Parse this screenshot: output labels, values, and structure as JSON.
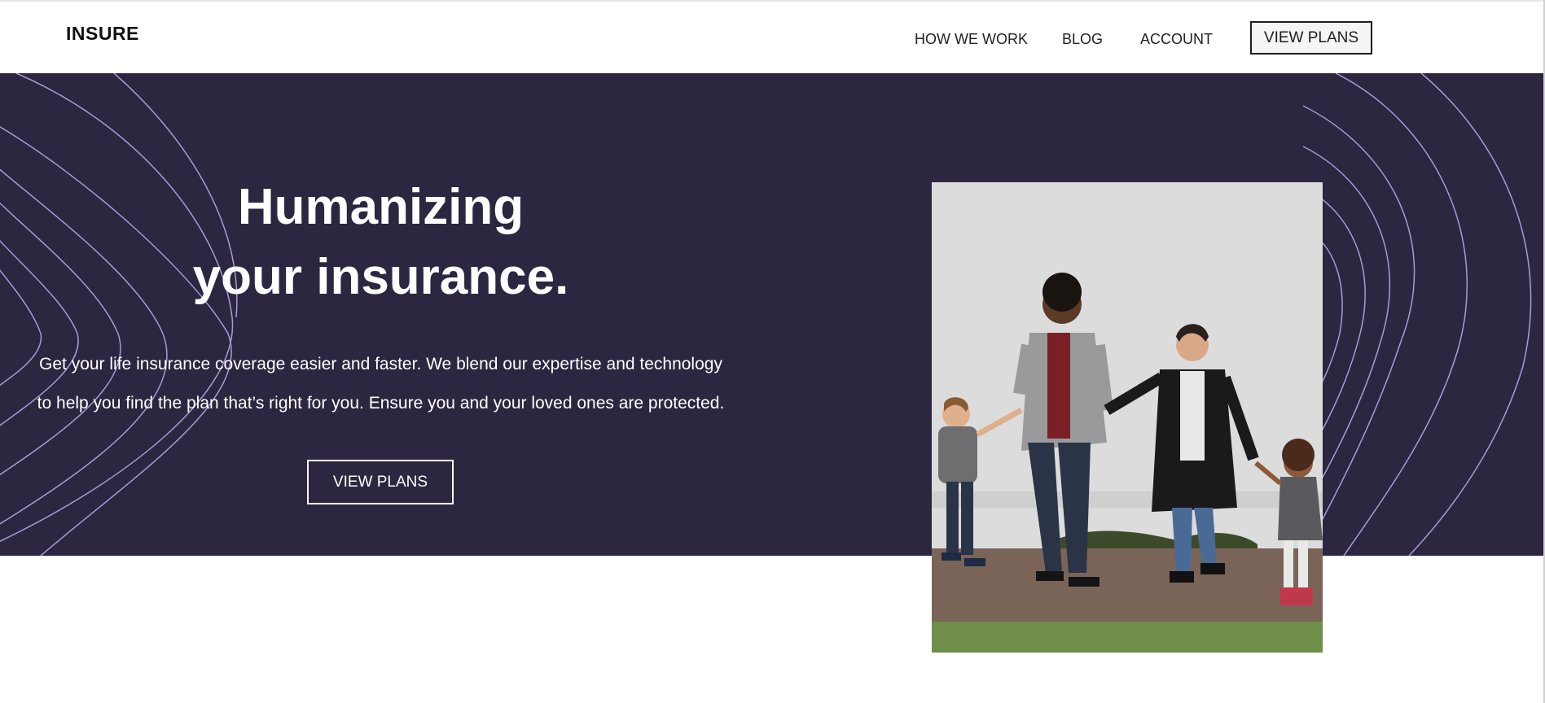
{
  "nav": {
    "logo": "INSURE",
    "links": [
      "HOW WE WORK",
      "BLOG",
      "ACCOUNT"
    ],
    "cta": "VIEW PLANS"
  },
  "hero": {
    "title_lines": [
      "Humanizing",
      "your insurance."
    ],
    "description_lines": [
      "Get your life insurance coverage easier and faster. We blend our expertise and technology",
      "to help you find the plan that’s right for you. Ensure you and your loved ones are protected."
    ],
    "cta": "VIEW PLANS"
  },
  "colors": {
    "hero_background": "#2c2640",
    "wave_stroke": "#a89bd6",
    "text_light": "#ffffff",
    "text_dark": "#1e1e1e"
  },
  "image": {
    "alt": "family of four holding hands"
  }
}
